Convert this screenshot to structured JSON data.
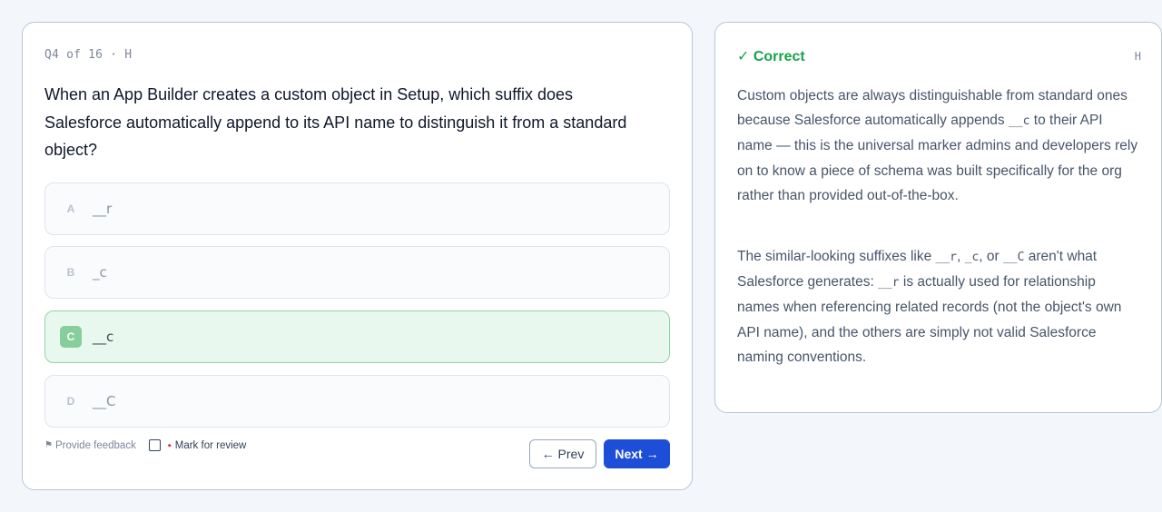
{
  "question": {
    "meta": "Q4 of 16 · H",
    "text": "When an App Builder creates a custom object in Setup, which suffix does Salesforce automatically append to its API name to distinguish it from a standard object?",
    "options": [
      {
        "letter": "A",
        "text": "__r",
        "state": "neutral"
      },
      {
        "letter": "B",
        "text": "_c",
        "state": "neutral"
      },
      {
        "letter": "C",
        "text": "__c",
        "state": "correct"
      },
      {
        "letter": "D",
        "text": "__C",
        "state": "neutral"
      }
    ],
    "feedback_label": "Provide feedback",
    "mark_label": "Mark for review",
    "mark_checked": false,
    "prev_label": "← Prev",
    "next_label": "Next →"
  },
  "explanation": {
    "status": "✓ Correct",
    "difficulty": "H",
    "p1": {
      "a": "Custom objects are always distinguishable from standard ones because Salesforce automatically appends ",
      "code": "__c",
      "b": " to their API name — this is the universal marker admins and developers rely on to know a piece of schema was built specifically for the org rather than provided out-of-the-box."
    },
    "p2": {
      "a": "The similar-looking suffixes like ",
      "c1": "__r",
      "sep1": ", ",
      "c2": "_c",
      "sep2": ", or ",
      "c3": "__C",
      "b": " aren't what Salesforce generates: ",
      "c4": "__r",
      "c": " is actually used for relationship names when referencing related records (not the object's own API name), and the others are simply not valid Salesforce naming conventions."
    }
  },
  "colors": {
    "correct": "#16a34a",
    "next_button": "#1d4ed8",
    "correct_option_bg": "#e9f8ee"
  },
  "icons": {
    "feedback": "flag-icon",
    "mark": "pin-icon"
  }
}
